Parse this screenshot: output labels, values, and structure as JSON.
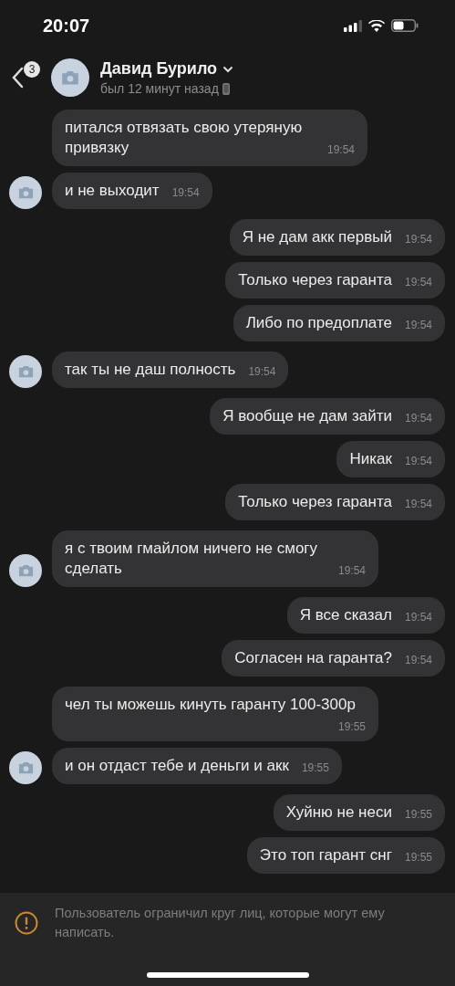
{
  "status_bar": {
    "time": "20:07"
  },
  "header": {
    "back_badge": "3",
    "name": "Давид Бурило",
    "status": "был 12 минут назад"
  },
  "messages": [
    {
      "kind": "incoming",
      "show_avatar": false,
      "text": "питался отвязать свою утеряную привязку",
      "time": "19:54"
    },
    {
      "kind": "incoming",
      "show_avatar": true,
      "text": "и не выходит",
      "time": "19:54"
    },
    {
      "kind": "outgoing",
      "show_avatar": false,
      "text": "Я не дам акк первый",
      "time": "19:54"
    },
    {
      "kind": "outgoing",
      "show_avatar": false,
      "text": "Только через гаранта",
      "time": "19:54"
    },
    {
      "kind": "outgoing",
      "show_avatar": false,
      "text": "Либо по предоплате",
      "time": "19:54"
    },
    {
      "kind": "incoming",
      "show_avatar": true,
      "text": "так ты не даш полность",
      "time": "19:54"
    },
    {
      "kind": "outgoing",
      "show_avatar": false,
      "text": "Я вообще не дам зайти",
      "time": "19:54"
    },
    {
      "kind": "outgoing",
      "show_avatar": false,
      "text": "Никак",
      "time": "19:54"
    },
    {
      "kind": "outgoing",
      "show_avatar": false,
      "text": "Только через гаранта",
      "time": "19:54"
    },
    {
      "kind": "incoming",
      "show_avatar": true,
      "text": "я с твоим гмайлом ничего не смогу сделать",
      "time": "19:54"
    },
    {
      "kind": "outgoing",
      "show_avatar": false,
      "text": "Я все сказал",
      "time": "19:54"
    },
    {
      "kind": "outgoing",
      "show_avatar": false,
      "text": "Согласен на гаранта?",
      "time": "19:54"
    },
    {
      "kind": "incoming",
      "show_avatar": false,
      "text": "чел ты можешь кинуть гаранту 100-300р",
      "time": "19:55"
    },
    {
      "kind": "incoming",
      "show_avatar": true,
      "text": "и он отдаст тебе и деньги  и акк",
      "time": "19:55"
    },
    {
      "kind": "outgoing",
      "show_avatar": false,
      "text": "Хуйню не неси",
      "time": "19:55"
    },
    {
      "kind": "outgoing",
      "show_avatar": false,
      "text": "Это топ гарант снг",
      "time": "19:55"
    }
  ],
  "notice": {
    "text": "Пользователь ограничил круг лиц, которые могут ему написать."
  }
}
